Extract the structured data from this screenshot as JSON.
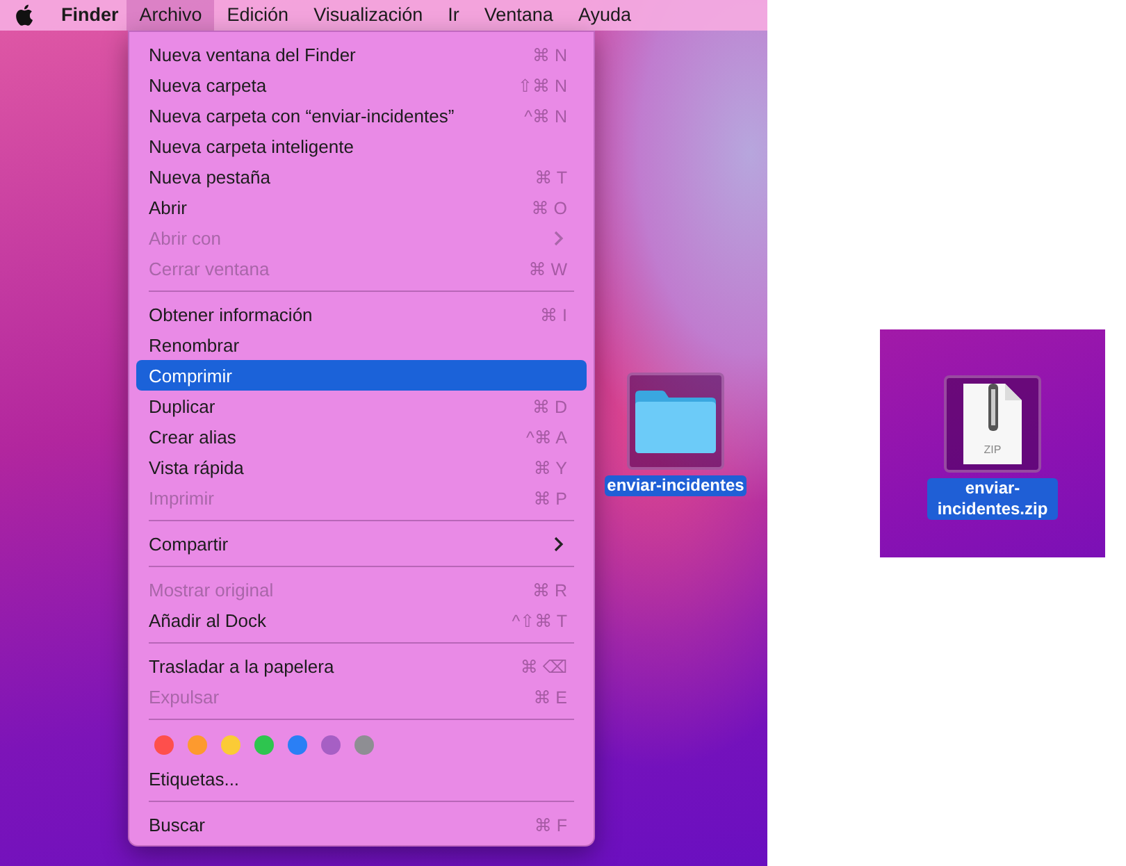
{
  "menu_bar": {
    "app_name": "Finder",
    "menus": [
      {
        "label": "Archivo",
        "selected": true
      },
      {
        "label": "Edición",
        "selected": false
      },
      {
        "label": "Visualización",
        "selected": false
      },
      {
        "label": "Ir",
        "selected": false
      },
      {
        "label": "Ventana",
        "selected": false
      },
      {
        "label": "Ayuda",
        "selected": false
      }
    ]
  },
  "file_menu": {
    "items": [
      {
        "kind": "item",
        "label": "Nueva ventana del Finder",
        "shortcut": "⌘ N",
        "disabled": false,
        "selected": false,
        "submenu": false
      },
      {
        "kind": "item",
        "label": "Nueva carpeta",
        "shortcut": "⇧⌘ N",
        "disabled": false,
        "selected": false,
        "submenu": false
      },
      {
        "kind": "item",
        "label": "Nueva carpeta con “enviar-incidentes”",
        "shortcut": "^⌘ N",
        "disabled": false,
        "selected": false,
        "submenu": false
      },
      {
        "kind": "item",
        "label": "Nueva carpeta inteligente",
        "disabled": false,
        "selected": false,
        "submenu": false
      },
      {
        "kind": "item",
        "label": "Nueva pestaña",
        "shortcut": "⌘ T",
        "disabled": false,
        "selected": false,
        "submenu": false
      },
      {
        "kind": "item",
        "label": "Abrir",
        "shortcut": "⌘ O",
        "disabled": false,
        "selected": false,
        "submenu": false
      },
      {
        "kind": "item",
        "label": "Abrir con",
        "disabled": true,
        "selected": false,
        "submenu": true
      },
      {
        "kind": "item",
        "label": "Cerrar ventana",
        "shortcut": "⌘ W",
        "disabled": true,
        "selected": false,
        "submenu": false
      },
      {
        "kind": "separator"
      },
      {
        "kind": "item",
        "label": "Obtener información",
        "shortcut": "⌘ I",
        "disabled": false,
        "selected": false,
        "submenu": false
      },
      {
        "kind": "item",
        "label": "Renombrar",
        "disabled": false,
        "selected": false,
        "submenu": false
      },
      {
        "kind": "item",
        "label": "Comprimir",
        "disabled": false,
        "selected": true,
        "submenu": false
      },
      {
        "kind": "item",
        "label": "Duplicar",
        "shortcut": "⌘ D",
        "disabled": false,
        "selected": false,
        "submenu": false
      },
      {
        "kind": "item",
        "label": "Crear alias",
        "shortcut": "^⌘ A",
        "disabled": false,
        "selected": false,
        "submenu": false
      },
      {
        "kind": "item",
        "label": "Vista rápida",
        "shortcut": "⌘ Y",
        "disabled": false,
        "selected": false,
        "submenu": false
      },
      {
        "kind": "item",
        "label": "Imprimir",
        "shortcut": "⌘ P",
        "disabled": true,
        "selected": false,
        "submenu": false
      },
      {
        "kind": "separator"
      },
      {
        "kind": "item",
        "label": "Compartir",
        "disabled": false,
        "selected": false,
        "submenu": true
      },
      {
        "kind": "separator"
      },
      {
        "kind": "item",
        "label": "Mostrar original",
        "shortcut": "⌘ R",
        "disabled": true,
        "selected": false,
        "submenu": false
      },
      {
        "kind": "item",
        "label": "Añadir al Dock",
        "shortcut": "^⇧⌘ T",
        "disabled": false,
        "selected": false,
        "submenu": false
      },
      {
        "kind": "separator"
      },
      {
        "kind": "item",
        "label": "Trasladar a la papelera",
        "shortcut": "⌘ ⌫",
        "disabled": false,
        "selected": false,
        "submenu": false
      },
      {
        "kind": "item",
        "label": "Expulsar",
        "shortcut": "⌘ E",
        "disabled": true,
        "selected": false,
        "submenu": false
      },
      {
        "kind": "separator"
      },
      {
        "kind": "tags",
        "tags": [
          {
            "color": "#fe4f4c"
          },
          {
            "color": "#fd9a2e"
          },
          {
            "color": "#fbcb36"
          },
          {
            "color": "#2ec54f"
          },
          {
            "color": "#2a7ff5"
          },
          {
            "color": "#a65fc4"
          },
          {
            "color": "#8e8e93"
          }
        ]
      },
      {
        "kind": "item",
        "label": "Etiquetas...",
        "disabled": false,
        "selected": false,
        "submenu": false
      },
      {
        "kind": "separator"
      },
      {
        "kind": "item",
        "label": "Buscar",
        "shortcut": "⌘ F",
        "disabled": false,
        "selected": false,
        "submenu": false
      }
    ]
  },
  "desktop_folder": {
    "label": "enviar-incidentes",
    "selected": true
  },
  "zip_file": {
    "label": "enviar-incidentes.zip",
    "badge": "ZIP",
    "selected": true
  }
}
